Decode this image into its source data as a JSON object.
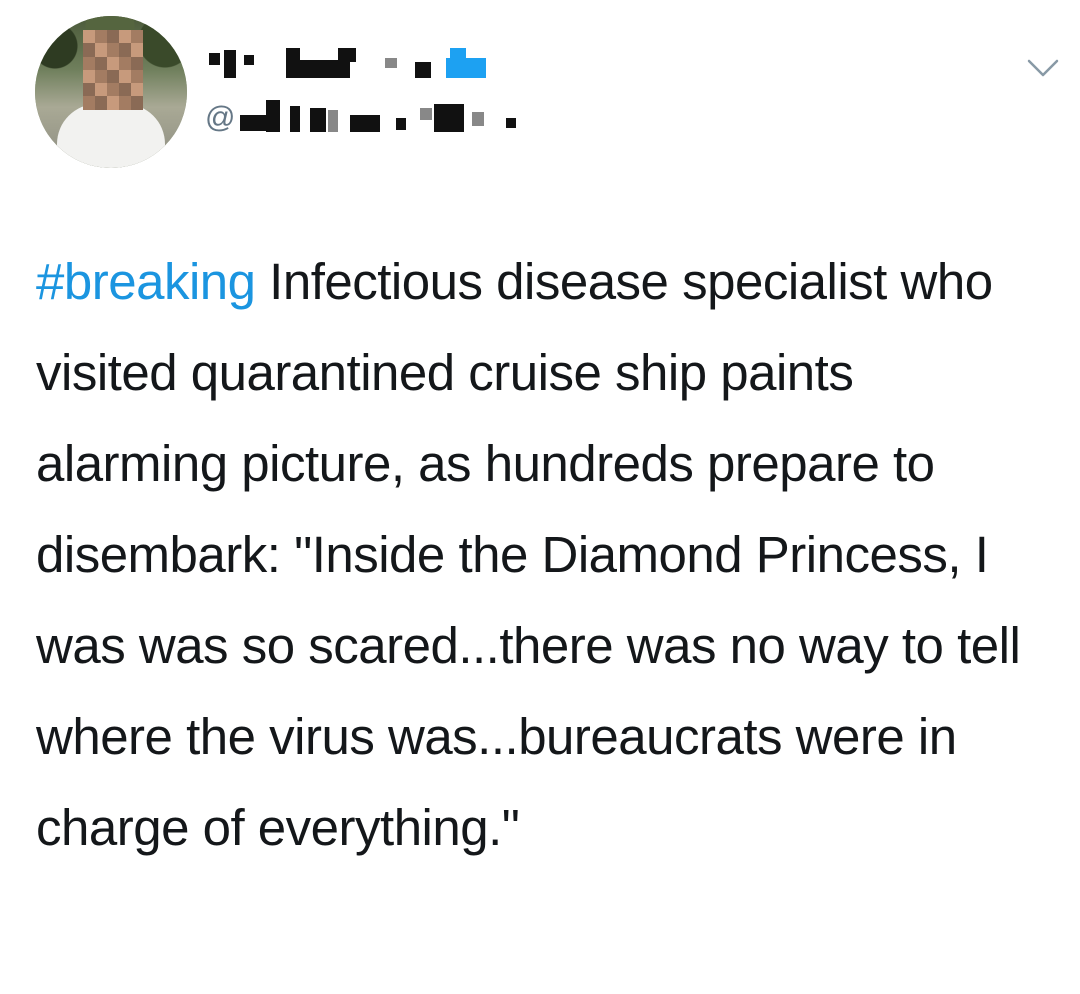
{
  "tweet": {
    "author": {
      "handle_prefix": "@"
    },
    "hashtag": "#breaking",
    "body": " Infectious disease specialist who visited quarantined cruise ship paints alarming picture, as hundreds prepare to disembark: \"Inside the Diamond Princess, I was was so scared...there was no way to tell where the virus was...bureaucrats were in charge of everything.\""
  },
  "icons": {
    "menu": "chevron-down-icon",
    "avatar": "avatar-photo"
  },
  "colors": {
    "hashtag": "#1b95e0",
    "text": "#14171a",
    "muted": "#657786"
  }
}
